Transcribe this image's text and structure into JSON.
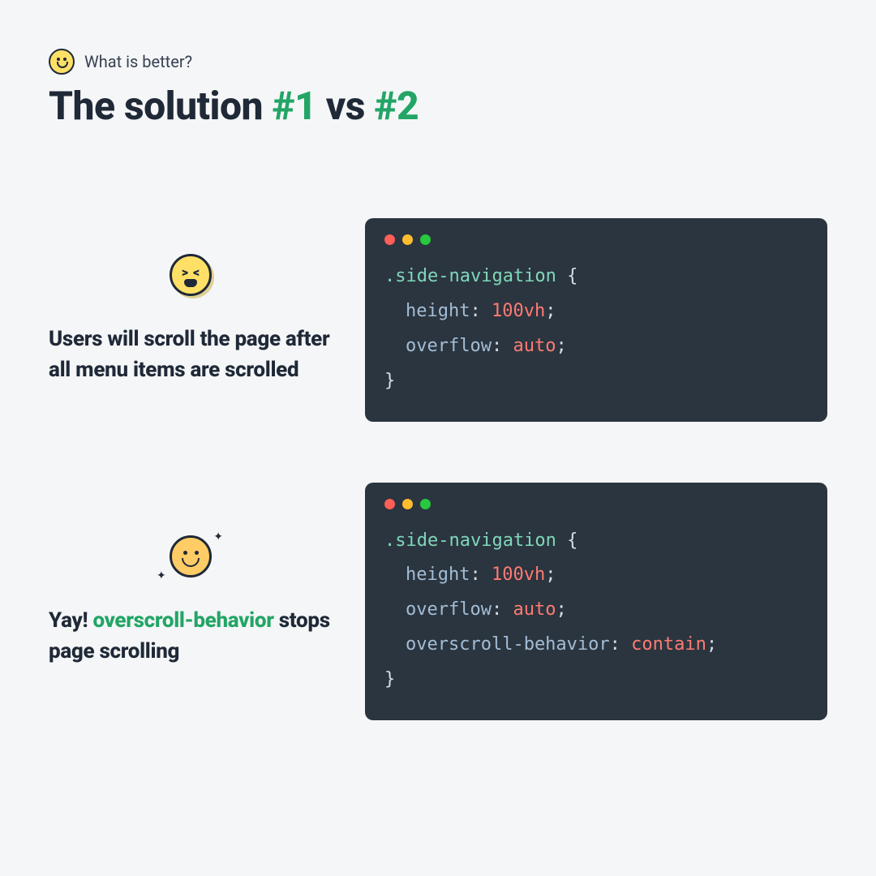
{
  "header": {
    "subtitle": "What is better?",
    "title_prefix": "The solution ",
    "title_num1": "#1",
    "title_vs": "  vs ",
    "title_num2": "#2"
  },
  "example1": {
    "description": "Users will scroll the page after all menu items are scrolled",
    "code": {
      "selector": ".side-navigation",
      "open_brace": " {",
      "close_brace": "}",
      "decl1_prop": "height",
      "decl1_colon": ": ",
      "decl1_val": "100vh",
      "decl1_semi": ";",
      "decl2_prop": "overflow",
      "decl2_colon": ": ",
      "decl2_val": "auto",
      "decl2_semi": ";"
    }
  },
  "example2": {
    "desc_pre": "Yay! ",
    "desc_highlight": "overscroll-behavior",
    "desc_post": " stops page scrolling",
    "code": {
      "selector": ".side-navigation",
      "open_brace": " {",
      "close_brace": "}",
      "decl1_prop": "height",
      "decl1_colon": ": ",
      "decl1_val": "100vh",
      "decl1_semi": ";",
      "decl2_prop": "overflow",
      "decl2_colon": ": ",
      "decl2_val": "auto",
      "decl2_semi": ";",
      "decl3_prop": "overscroll-behavior",
      "decl3_colon": ": ",
      "decl3_val": "contain",
      "decl3_semi": ";"
    }
  }
}
